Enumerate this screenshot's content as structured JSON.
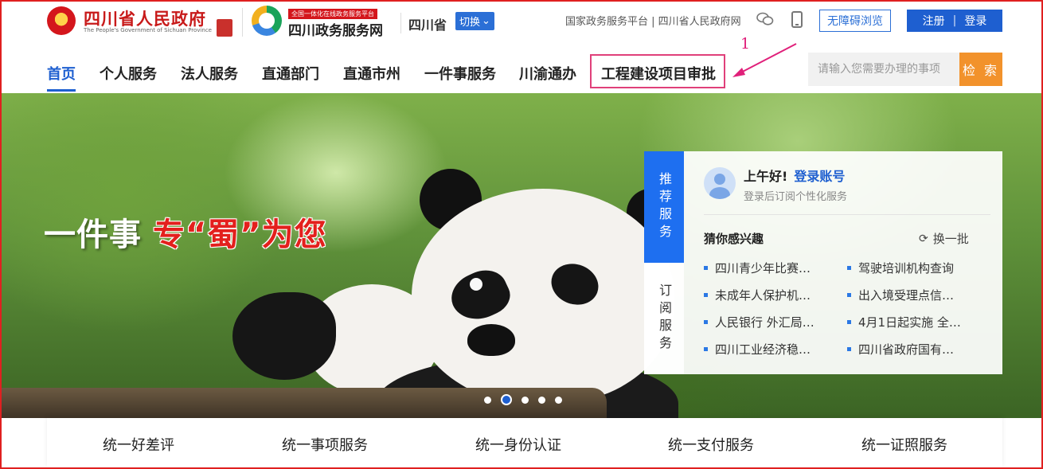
{
  "header": {
    "gov_name": "四川省人民政府",
    "gov_name_en": "The People's Government of Sichuan Province",
    "platform_tag": "全国一体化在线政务服务平台",
    "platform_name": "四川政务服务网",
    "region": "四川省",
    "switch_label": "切换",
    "top_links": "国家政务服务平台 | 四川省人民政府网",
    "accessibility_label": "无障碍浏览",
    "register_label": "注册",
    "login_label": "登录"
  },
  "nav": {
    "items": [
      "首页",
      "个人服务",
      "法人服务",
      "直通部门",
      "直通市州",
      "一件事服务",
      "川渝通办",
      "工程建设项目审批"
    ],
    "search_placeholder": "请输入您需要办理的事项",
    "search_button": "检 索",
    "annotation_number": "1"
  },
  "banner": {
    "slogan_white": "一件事",
    "slogan_red": "专“蜀”为您",
    "slide_count": 5,
    "active_slide": 2
  },
  "service_panel": {
    "tab_recommended": "推荐服务",
    "tab_subscribe": "订阅服务",
    "greeting": "上午好!",
    "login_link": "登录账号",
    "login_hint": "登录后订阅个性化服务",
    "interest_title": "猜你感兴趣",
    "refresh_label": "换一批",
    "items": [
      "四川青少年比赛…",
      "驾驶培训机构查询",
      "未成年人保护机…",
      "出入境受理点信…",
      "人民银行 外汇局…",
      "4月1日起实施 全…",
      "四川工业经济稳…",
      "四川省政府国有…"
    ]
  },
  "bottom_bar": {
    "items": [
      "统一好差评",
      "统一事项服务",
      "统一身份认证",
      "统一支付服务",
      "统一证照服务"
    ]
  },
  "colors": {
    "brand_blue": "#1e5fd0",
    "gov_red": "#c81a1a",
    "search_orange": "#f2922b",
    "annotation_pink": "#e0407a"
  }
}
